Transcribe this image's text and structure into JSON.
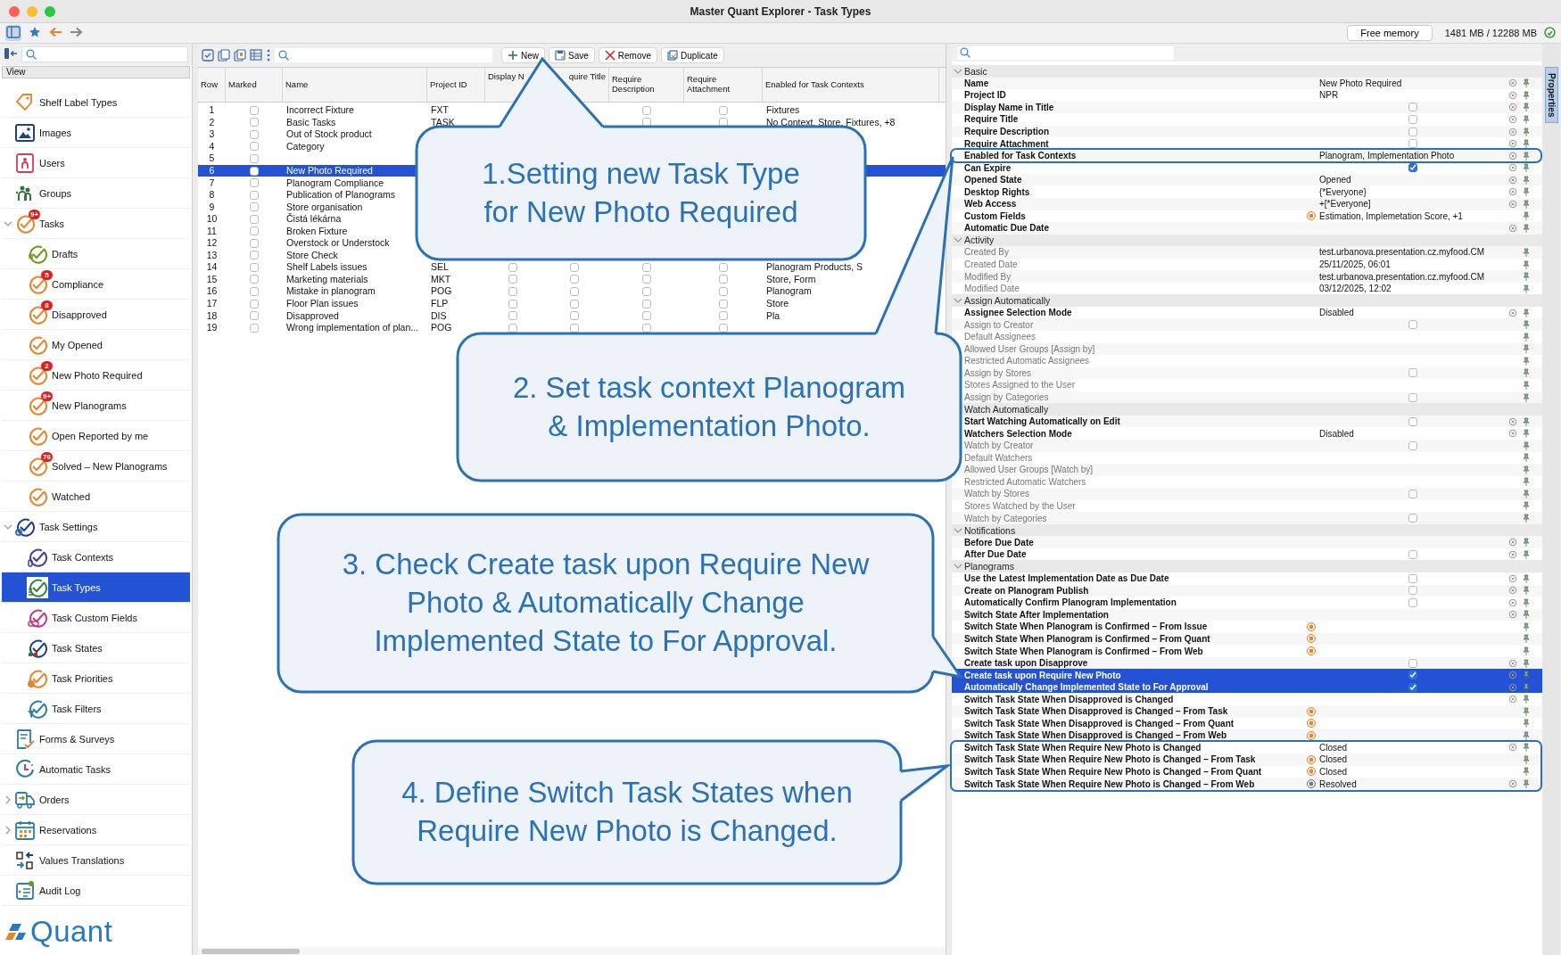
{
  "window": {
    "title": "Master Quant Explorer - Task Types"
  },
  "toolbar": {
    "free_memory_button": "Free memory",
    "memory": "1481 MB / 12288 MB"
  },
  "sidebar": {
    "view_label": "View",
    "logo": "Quant",
    "items": [
      {
        "label": "Shelf Label Types",
        "selected": false
      },
      {
        "label": "Images",
        "selected": false
      },
      {
        "label": "Users",
        "selected": false
      },
      {
        "label": "Groups",
        "selected": false
      },
      {
        "label": "Tasks",
        "selected": false,
        "badge": "9+",
        "expanded": true,
        "children": [
          {
            "label": "Drafts",
            "selected": false
          },
          {
            "label": "Compliance",
            "selected": false,
            "badge": "5"
          },
          {
            "label": "Disapproved",
            "selected": false,
            "badge": "8"
          },
          {
            "label": "My Opened",
            "selected": false
          },
          {
            "label": "New Photo Required",
            "selected": false,
            "badge": "2"
          },
          {
            "label": "New Planograms",
            "selected": false,
            "badge": "9+"
          },
          {
            "label": "Open Reported by me",
            "selected": false
          },
          {
            "label": "Solved – New Planograms",
            "selected": false,
            "badge": "76"
          },
          {
            "label": "Watched",
            "selected": false
          }
        ]
      },
      {
        "label": "Task Settings",
        "selected": false,
        "expanded": true,
        "children": [
          {
            "label": "Task Contexts",
            "selected": false
          },
          {
            "label": "Task Types",
            "selected": true
          },
          {
            "label": "Task Custom Fields",
            "selected": false
          },
          {
            "label": "Task States",
            "selected": false
          },
          {
            "label": "Task Priorities",
            "selected": false
          },
          {
            "label": "Task Filters",
            "selected": false
          }
        ]
      },
      {
        "label": "Forms & Surveys",
        "selected": false
      },
      {
        "label": "Automatic Tasks",
        "selected": false
      },
      {
        "label": "Orders",
        "selected": false,
        "expanded": false
      },
      {
        "label": "Reservations",
        "selected": false,
        "expanded": false
      },
      {
        "label": "Values Translations",
        "selected": false
      },
      {
        "label": "Audit Log",
        "selected": false
      }
    ]
  },
  "table_toolbar": {
    "buttons": [
      {
        "kind": "add",
        "label": "New"
      },
      {
        "kind": "save",
        "label": "Save"
      },
      {
        "kind": "remove",
        "label": "Remove"
      },
      {
        "kind": "duplicate",
        "label": "Duplicate"
      }
    ]
  },
  "table": {
    "columns": [
      {
        "kind": "text",
        "label": "Row"
      },
      {
        "kind": "check",
        "label": "Marked"
      },
      {
        "kind": "text",
        "label": "Name"
      },
      {
        "kind": "text",
        "label": "Project ID"
      },
      {
        "kind": "check",
        "label": "Display N"
      },
      {
        "kind": "check",
        "label": "quire Title"
      },
      {
        "kind": "check",
        "label": "Require Description"
      },
      {
        "kind": "check",
        "label": "Require Attachment"
      },
      {
        "kind": "text",
        "label": "Enabled for Task Contexts"
      }
    ],
    "rows": [
      {
        "selected": false,
        "cells": [
          "1",
          false,
          "Incorrect Fixture",
          "FXT",
          null,
          null,
          false,
          false,
          "Fixtures"
        ]
      },
      {
        "selected": false,
        "cells": [
          "2",
          false,
          "Basic Tasks",
          "TASK",
          null,
          null,
          false,
          false,
          "No Context, Store, Fixtures, +8"
        ]
      },
      {
        "selected": false,
        "cells": [
          "3",
          false,
          "Out of Stock product",
          null,
          null,
          null,
          null,
          null,
          null
        ]
      },
      {
        "selected": false,
        "cells": [
          "4",
          false,
          "Category",
          null,
          null,
          null,
          null,
          null,
          null
        ]
      },
      {
        "selected": false,
        "cells": [
          "5",
          false,
          null,
          null,
          null,
          null,
          null,
          null,
          null
        ]
      },
      {
        "selected": true,
        "cells": [
          "6",
          false,
          "New Photo Required",
          null,
          null,
          null,
          null,
          null,
          null
        ]
      },
      {
        "selected": false,
        "cells": [
          "7",
          false,
          "Planogram Compliance",
          null,
          null,
          null,
          null,
          null,
          null
        ]
      },
      {
        "selected": false,
        "cells": [
          "8",
          false,
          "Publication of Planograms",
          null,
          null,
          null,
          null,
          null,
          null
        ]
      },
      {
        "selected": false,
        "cells": [
          "9",
          false,
          "Store organisation",
          null,
          null,
          null,
          null,
          null,
          null
        ]
      },
      {
        "selected": false,
        "cells": [
          "10",
          false,
          "Čistá lékárna",
          null,
          null,
          null,
          null,
          null,
          null
        ]
      },
      {
        "selected": false,
        "cells": [
          "11",
          false,
          "Broken Fixture",
          null,
          null,
          null,
          null,
          null,
          null
        ]
      },
      {
        "selected": false,
        "cells": [
          "12",
          false,
          "Overstock or Understock",
          null,
          null,
          null,
          null,
          null,
          null
        ]
      },
      {
        "selected": false,
        "cells": [
          "13",
          false,
          "Store Check",
          null,
          null,
          null,
          null,
          null,
          null
        ]
      },
      {
        "selected": false,
        "cells": [
          "14",
          false,
          "Shelf Labels issues",
          "SEL",
          false,
          false,
          false,
          false,
          "Planogram Products, S"
        ]
      },
      {
        "selected": false,
        "cells": [
          "15",
          false,
          "Marketing materials",
          "MKT",
          false,
          false,
          false,
          false,
          "Store, Form"
        ]
      },
      {
        "selected": false,
        "cells": [
          "16",
          false,
          "Mistake in planogram",
          "POG",
          false,
          false,
          false,
          false,
          "Planogram"
        ]
      },
      {
        "selected": false,
        "cells": [
          "17",
          false,
          "Floor Plan issues",
          "FLP",
          false,
          false,
          false,
          false,
          "Store"
        ]
      },
      {
        "selected": false,
        "cells": [
          "18",
          false,
          "Disapproved",
          "DIS",
          false,
          false,
          false,
          false,
          "Pla"
        ]
      },
      {
        "selected": false,
        "cells": [
          "19",
          false,
          "Wrong implementation of plan...",
          "POG",
          false,
          false,
          false,
          false,
          null
        ]
      }
    ]
  },
  "properties": {
    "tab": "Properties",
    "sections": [
      {
        "title": "Basic",
        "expanded": true,
        "rows": [
          {
            "label": "Name",
            "value": "New Photo Required",
            "selected": false,
            "disabled": false,
            "resettable": true,
            "framed": false
          },
          {
            "label": "Project ID",
            "value": "NPR",
            "selected": false,
            "disabled": false,
            "resettable": true,
            "framed": false
          },
          {
            "label": "Display Name in Title",
            "checked": false,
            "selected": false,
            "disabled": false,
            "resettable": true,
            "framed": false
          },
          {
            "label": "Require Title",
            "checked": false,
            "selected": false,
            "disabled": false,
            "resettable": true,
            "framed": false
          },
          {
            "label": "Require Description",
            "checked": false,
            "selected": false,
            "disabled": false,
            "resettable": true,
            "framed": false
          },
          {
            "label": "Require Attachment",
            "checked": false,
            "selected": false,
            "disabled": false,
            "resettable": true,
            "framed": false
          },
          {
            "label": "Enabled for Task Contexts",
            "value": "Planogram, Implementation Photo",
            "selected": false,
            "disabled": false,
            "resettable": true,
            "framed": true
          },
          {
            "label": "Can Expire",
            "checked": true,
            "selected": false,
            "disabled": false,
            "resettable": true,
            "framed": false
          },
          {
            "label": "Opened State",
            "value": "Opened",
            "selected": false,
            "disabled": false,
            "resettable": true,
            "framed": false
          },
          {
            "label": "Desktop Rights",
            "value": "{*Everyone}",
            "selected": false,
            "disabled": false,
            "resettable": true,
            "framed": false
          },
          {
            "label": "Web Access",
            "value": "+[*Everyone]",
            "selected": false,
            "disabled": false,
            "resettable": true,
            "framed": false
          },
          {
            "label": "Custom Fields",
            "color": "#e8832a",
            "value": "Estimation, Implemetation Score, +1",
            "selected": false,
            "disabled": false,
            "resettable": false,
            "framed": false
          },
          {
            "label": "Automatic Due Date",
            "selected": false,
            "disabled": false,
            "resettable": true,
            "framed": false
          }
        ]
      },
      {
        "title": "Activity",
        "expanded": true,
        "rows": [
          {
            "label": "Created By",
            "value": "test.urbanova.presentation.cz.myfood.CM",
            "selected": false,
            "disabled": true,
            "resettable": false,
            "framed": false
          },
          {
            "label": "Created Date",
            "value": "25/11/2025, 06:01",
            "selected": false,
            "disabled": true,
            "resettable": false,
            "framed": false
          },
          {
            "label": "Modified By",
            "value": "test.urbanova.presentation.cz.myfood.CM",
            "selected": false,
            "disabled": true,
            "resettable": false,
            "framed": false
          },
          {
            "label": "Modified Date",
            "value": "03/12/2025, 12:02",
            "selected": false,
            "disabled": true,
            "resettable": false,
            "framed": false
          }
        ]
      },
      {
        "title": "Assign Automatically",
        "expanded": true,
        "rows": [
          {
            "label": "Assignee Selection Mode",
            "value": "Disabled",
            "selected": false,
            "disabled": false,
            "resettable": true,
            "framed": false
          },
          {
            "label": "Assign to Creator",
            "checked": false,
            "selected": false,
            "disabled": true,
            "resettable": false,
            "framed": false
          },
          {
            "label": "Default Assignees",
            "selected": false,
            "disabled": true,
            "resettable": false,
            "framed": false
          },
          {
            "label": "Allowed User Groups [Assign by]",
            "selected": false,
            "disabled": true,
            "resettable": false,
            "framed": false
          },
          {
            "label": "Restricted Automatic Assignees",
            "selected": false,
            "disabled": true,
            "resettable": false,
            "framed": false
          },
          {
            "label": "Assign by Stores",
            "checked": false,
            "selected": false,
            "disabled": true,
            "resettable": false,
            "framed": false
          },
          {
            "label": "Stores Assigned to the User",
            "selected": false,
            "disabled": true,
            "resettable": false,
            "framed": false
          },
          {
            "label": "Assign by Categories",
            "checked": false,
            "selected": false,
            "disabled": true,
            "resettable": false,
            "framed": false
          }
        ]
      },
      {
        "title": "Watch Automatically",
        "rows": [
          {
            "label": "Start Watching Automatically on Edit",
            "checked": false,
            "selected": false,
            "disabled": false,
            "resettable": true,
            "framed": false
          },
          {
            "label": "Watchers Selection Mode",
            "value": "Disabled",
            "selected": false,
            "disabled": false,
            "resettable": true,
            "framed": false
          },
          {
            "label": "Watch by Creator",
            "checked": false,
            "selected": false,
            "disabled": true,
            "resettable": false,
            "framed": false
          },
          {
            "label": "Default Watchers",
            "selected": false,
            "disabled": true,
            "resettable": false,
            "framed": false
          },
          {
            "label": "Allowed User Groups [Watch by]",
            "selected": false,
            "disabled": true,
            "resettable": false,
            "framed": false
          },
          {
            "label": "Restricted Automatic Watchers",
            "selected": false,
            "disabled": true,
            "resettable": false,
            "framed": false
          },
          {
            "label": "Watch by Stores",
            "checked": false,
            "selected": false,
            "disabled": true,
            "resettable": false,
            "framed": false
          },
          {
            "label": "Stores Watched by the User",
            "selected": false,
            "disabled": true,
            "resettable": false,
            "framed": false
          },
          {
            "label": "Watch by Categories",
            "checked": false,
            "selected": false,
            "disabled": true,
            "resettable": false,
            "framed": false
          }
        ]
      },
      {
        "title": "Notifications",
        "expanded": true,
        "rows": [
          {
            "label": "Before Due Date",
            "selected": false,
            "disabled": false,
            "resettable": true,
            "framed": false
          },
          {
            "label": "After Due Date",
            "checked": false,
            "selected": false,
            "disabled": false,
            "resettable": true,
            "framed": false
          }
        ]
      },
      {
        "title": "Planograms",
        "expanded": true,
        "rows": [
          {
            "label": "Use the Latest Implementation Date as Due Date",
            "checked": false,
            "selected": false,
            "disabled": false,
            "resettable": true,
            "framed": false
          },
          {
            "label": "Create on Planogram Publish",
            "checked": false,
            "selected": false,
            "disabled": false,
            "resettable": true,
            "framed": false
          },
          {
            "label": "Automatically Confirm Planogram Implementation",
            "checked": false,
            "selected": false,
            "disabled": false,
            "resettable": true,
            "framed": false
          },
          {
            "label": "Switch State After Implementation",
            "selected": false,
            "disabled": false,
            "resettable": true,
            "framed": false
          },
          {
            "label": "Switch State When Planogram is Confirmed – From Issue",
            "color": "#e8832a",
            "selected": false,
            "disabled": false,
            "resettable": false,
            "framed": false
          },
          {
            "label": "Switch State When Planogram is Confirmed – From Quant",
            "color": "#e8832a",
            "selected": false,
            "disabled": false,
            "resettable": false,
            "framed": false
          },
          {
            "label": "Switch State When Planogram is Confirmed – From Web",
            "color": "#e8832a",
            "selected": false,
            "disabled": false,
            "resettable": false,
            "framed": false
          },
          {
            "label": "Create task upon Disapprove",
            "checked": false,
            "selected": false,
            "disabled": false,
            "resettable": true,
            "framed": false
          },
          {
            "label": "Create task upon Require New Photo",
            "checked": true,
            "selected": true,
            "disabled": false,
            "resettable": true,
            "framed": false
          },
          {
            "label": "Automatically Change Implemented State to For Approval",
            "checked": true,
            "selected": true,
            "disabled": false,
            "resettable": true,
            "framed": false
          },
          {
            "label": "Switch Task State When Disapproved is Changed",
            "selected": false,
            "disabled": false,
            "resettable": true,
            "framed": false
          },
          {
            "label": "Switch Task State When Disapproved is Changed – From Task",
            "color": "#e8832a",
            "selected": false,
            "disabled": false,
            "resettable": false,
            "framed": false
          },
          {
            "label": "Switch Task State When Disapproved is Changed – From Quant",
            "color": "#e8832a",
            "selected": false,
            "disabled": false,
            "resettable": false,
            "framed": false
          },
          {
            "label": "Switch Task State When Disapproved is Changed – From Web",
            "color": "#e8832a",
            "selected": false,
            "disabled": false,
            "resettable": false,
            "framed": false
          },
          {
            "label": "Switch Task State When Require New Photo is Changed",
            "value": "Closed",
            "selected": false,
            "disabled": false,
            "resettable": true,
            "framed": true
          },
          {
            "label": "Switch Task State When Require New Photo is Changed – From Task",
            "color": "#e8832a",
            "value": "Closed",
            "selected": false,
            "disabled": false,
            "resettable": false,
            "framed": true
          },
          {
            "label": "Switch Task State When Require New Photo is Changed – From Quant",
            "color": "#e8832a",
            "value": "Closed",
            "selected": false,
            "disabled": false,
            "resettable": false,
            "framed": true
          },
          {
            "label": "Switch Task State When Require New Photo is Changed – From Web",
            "color": "#777777",
            "value": "Resolved",
            "selected": false,
            "disabled": false,
            "resettable": true,
            "framed": true
          }
        ]
      }
    ]
  },
  "callouts": [
    {
      "text": "1.Setting new Task Type for New Photo Required"
    },
    {
      "text": "2. Set task context Planogram & Implementation Photo."
    },
    {
      "text": "3. Check Create task upon Require New Photo & Automatically Change Implemented State to For Approval."
    },
    {
      "text": "4. Define Switch Task States when Require New Photo is Changed."
    }
  ]
}
